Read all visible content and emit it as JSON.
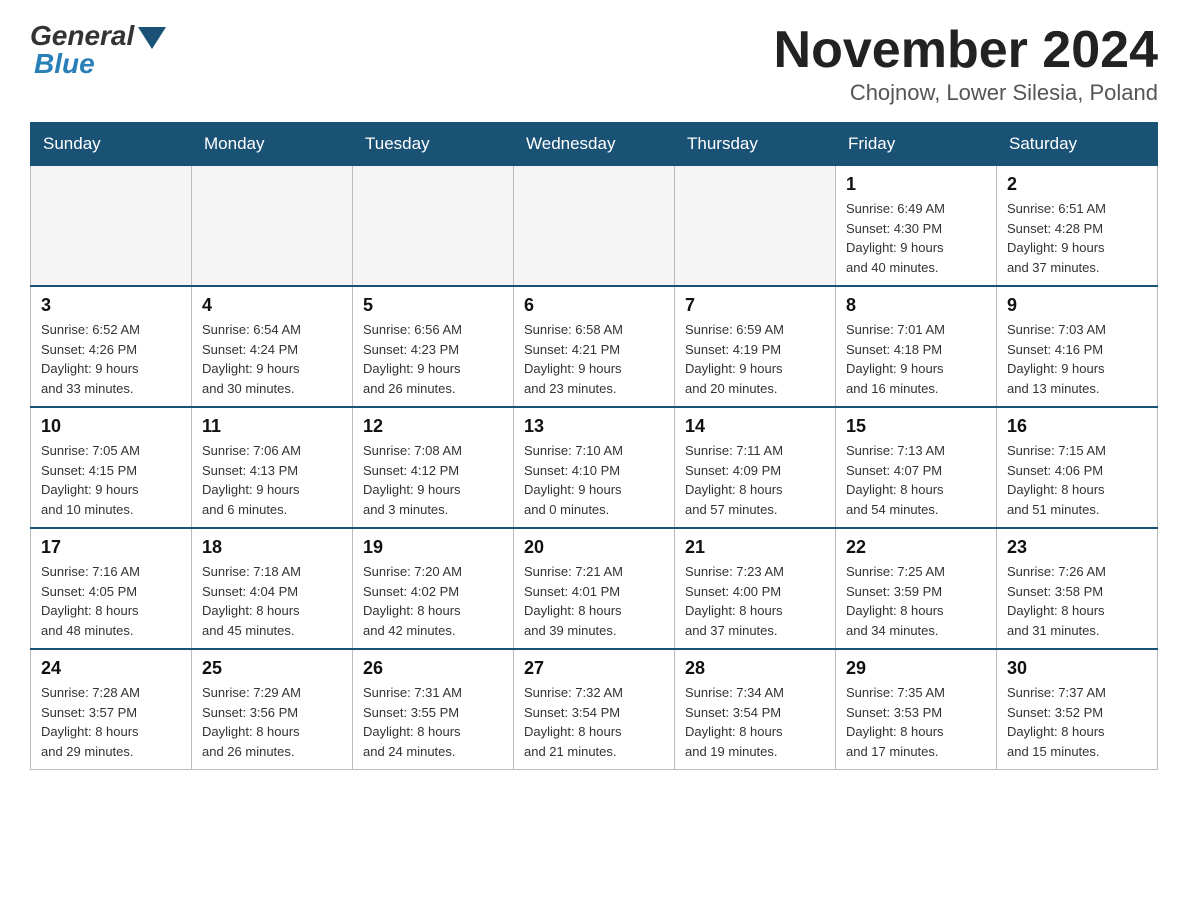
{
  "header": {
    "logo": {
      "general": "General",
      "blue": "Blue"
    },
    "title": "November 2024",
    "location": "Chojnow, Lower Silesia, Poland"
  },
  "weekdays": [
    "Sunday",
    "Monday",
    "Tuesday",
    "Wednesday",
    "Thursday",
    "Friday",
    "Saturday"
  ],
  "weeks": [
    [
      {
        "day": "",
        "info": ""
      },
      {
        "day": "",
        "info": ""
      },
      {
        "day": "",
        "info": ""
      },
      {
        "day": "",
        "info": ""
      },
      {
        "day": "",
        "info": ""
      },
      {
        "day": "1",
        "info": "Sunrise: 6:49 AM\nSunset: 4:30 PM\nDaylight: 9 hours\nand 40 minutes."
      },
      {
        "day": "2",
        "info": "Sunrise: 6:51 AM\nSunset: 4:28 PM\nDaylight: 9 hours\nand 37 minutes."
      }
    ],
    [
      {
        "day": "3",
        "info": "Sunrise: 6:52 AM\nSunset: 4:26 PM\nDaylight: 9 hours\nand 33 minutes."
      },
      {
        "day": "4",
        "info": "Sunrise: 6:54 AM\nSunset: 4:24 PM\nDaylight: 9 hours\nand 30 minutes."
      },
      {
        "day": "5",
        "info": "Sunrise: 6:56 AM\nSunset: 4:23 PM\nDaylight: 9 hours\nand 26 minutes."
      },
      {
        "day": "6",
        "info": "Sunrise: 6:58 AM\nSunset: 4:21 PM\nDaylight: 9 hours\nand 23 minutes."
      },
      {
        "day": "7",
        "info": "Sunrise: 6:59 AM\nSunset: 4:19 PM\nDaylight: 9 hours\nand 20 minutes."
      },
      {
        "day": "8",
        "info": "Sunrise: 7:01 AM\nSunset: 4:18 PM\nDaylight: 9 hours\nand 16 minutes."
      },
      {
        "day": "9",
        "info": "Sunrise: 7:03 AM\nSunset: 4:16 PM\nDaylight: 9 hours\nand 13 minutes."
      }
    ],
    [
      {
        "day": "10",
        "info": "Sunrise: 7:05 AM\nSunset: 4:15 PM\nDaylight: 9 hours\nand 10 minutes."
      },
      {
        "day": "11",
        "info": "Sunrise: 7:06 AM\nSunset: 4:13 PM\nDaylight: 9 hours\nand 6 minutes."
      },
      {
        "day": "12",
        "info": "Sunrise: 7:08 AM\nSunset: 4:12 PM\nDaylight: 9 hours\nand 3 minutes."
      },
      {
        "day": "13",
        "info": "Sunrise: 7:10 AM\nSunset: 4:10 PM\nDaylight: 9 hours\nand 0 minutes."
      },
      {
        "day": "14",
        "info": "Sunrise: 7:11 AM\nSunset: 4:09 PM\nDaylight: 8 hours\nand 57 minutes."
      },
      {
        "day": "15",
        "info": "Sunrise: 7:13 AM\nSunset: 4:07 PM\nDaylight: 8 hours\nand 54 minutes."
      },
      {
        "day": "16",
        "info": "Sunrise: 7:15 AM\nSunset: 4:06 PM\nDaylight: 8 hours\nand 51 minutes."
      }
    ],
    [
      {
        "day": "17",
        "info": "Sunrise: 7:16 AM\nSunset: 4:05 PM\nDaylight: 8 hours\nand 48 minutes."
      },
      {
        "day": "18",
        "info": "Sunrise: 7:18 AM\nSunset: 4:04 PM\nDaylight: 8 hours\nand 45 minutes."
      },
      {
        "day": "19",
        "info": "Sunrise: 7:20 AM\nSunset: 4:02 PM\nDaylight: 8 hours\nand 42 minutes."
      },
      {
        "day": "20",
        "info": "Sunrise: 7:21 AM\nSunset: 4:01 PM\nDaylight: 8 hours\nand 39 minutes."
      },
      {
        "day": "21",
        "info": "Sunrise: 7:23 AM\nSunset: 4:00 PM\nDaylight: 8 hours\nand 37 minutes."
      },
      {
        "day": "22",
        "info": "Sunrise: 7:25 AM\nSunset: 3:59 PM\nDaylight: 8 hours\nand 34 minutes."
      },
      {
        "day": "23",
        "info": "Sunrise: 7:26 AM\nSunset: 3:58 PM\nDaylight: 8 hours\nand 31 minutes."
      }
    ],
    [
      {
        "day": "24",
        "info": "Sunrise: 7:28 AM\nSunset: 3:57 PM\nDaylight: 8 hours\nand 29 minutes."
      },
      {
        "day": "25",
        "info": "Sunrise: 7:29 AM\nSunset: 3:56 PM\nDaylight: 8 hours\nand 26 minutes."
      },
      {
        "day": "26",
        "info": "Sunrise: 7:31 AM\nSunset: 3:55 PM\nDaylight: 8 hours\nand 24 minutes."
      },
      {
        "day": "27",
        "info": "Sunrise: 7:32 AM\nSunset: 3:54 PM\nDaylight: 8 hours\nand 21 minutes."
      },
      {
        "day": "28",
        "info": "Sunrise: 7:34 AM\nSunset: 3:54 PM\nDaylight: 8 hours\nand 19 minutes."
      },
      {
        "day": "29",
        "info": "Sunrise: 7:35 AM\nSunset: 3:53 PM\nDaylight: 8 hours\nand 17 minutes."
      },
      {
        "day": "30",
        "info": "Sunrise: 7:37 AM\nSunset: 3:52 PM\nDaylight: 8 hours\nand 15 minutes."
      }
    ]
  ]
}
